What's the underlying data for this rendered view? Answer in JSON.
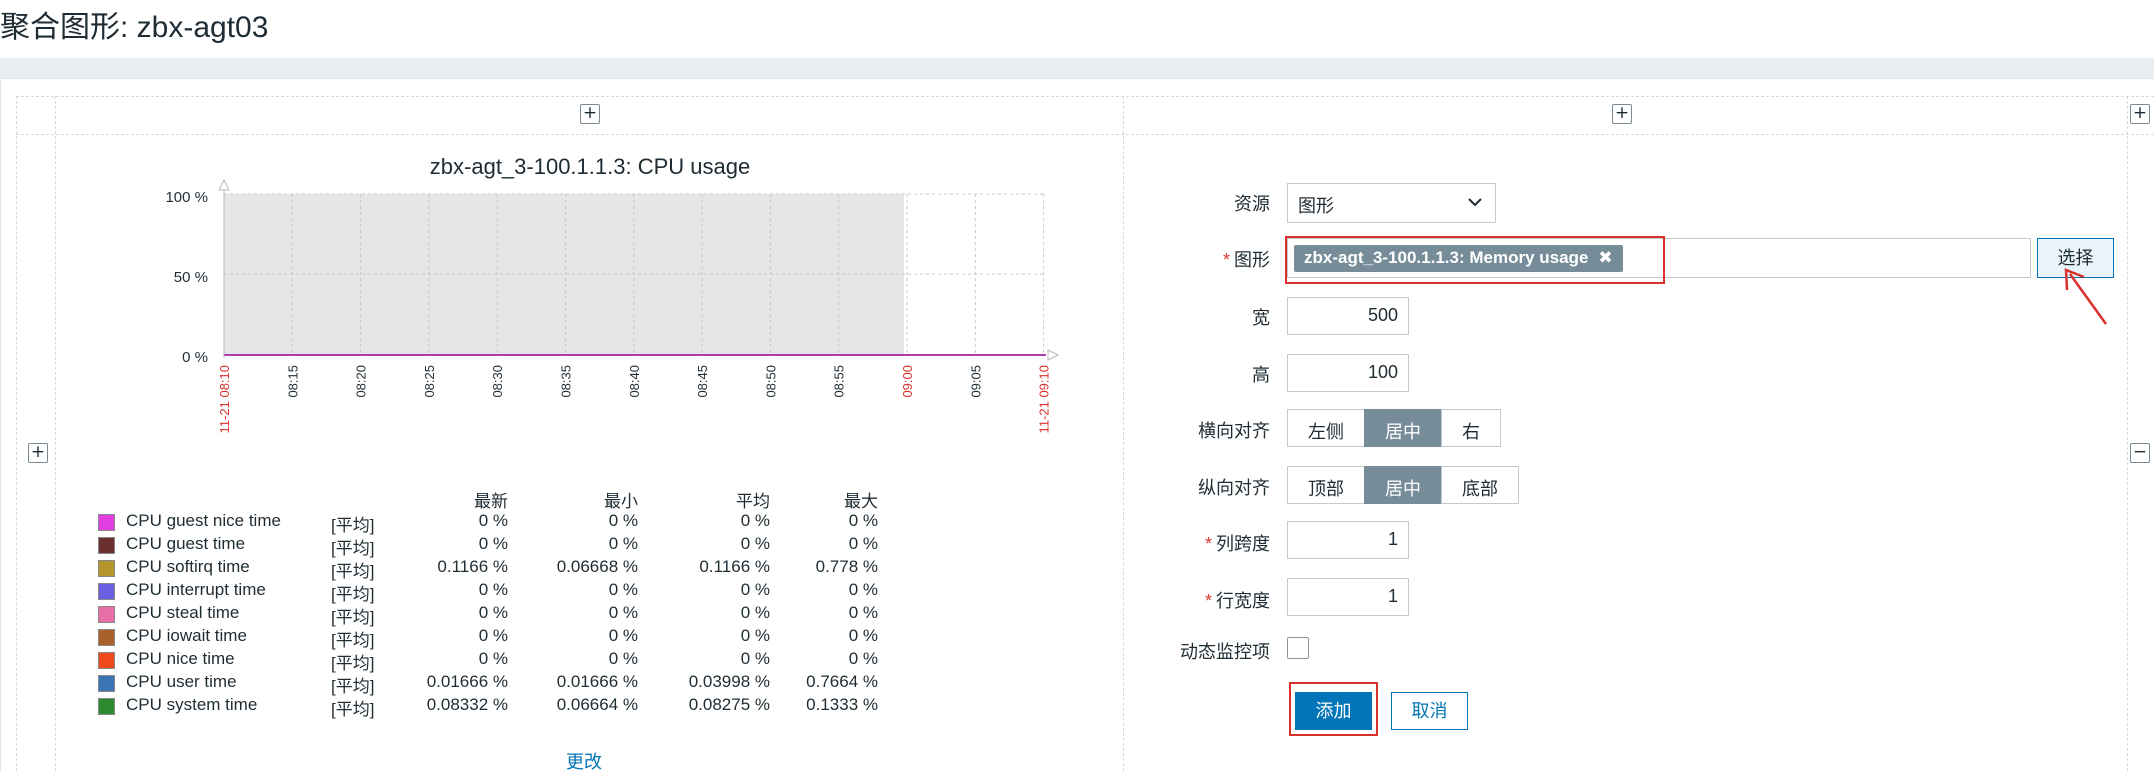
{
  "page": {
    "title": "聚合图形: zbx-agt03"
  },
  "graph": {
    "title": "zbx-agt_3-100.1.1.3: CPU usage",
    "y_ticks": [
      "100 %",
      "50 %",
      "0 %"
    ],
    "x_ticks": [
      "11-21 08:10",
      "08:15",
      "08:20",
      "08:25",
      "08:30",
      "08:35",
      "08:40",
      "08:45",
      "08:50",
      "08:55",
      "09:00",
      "09:05",
      "11-21 09:10"
    ],
    "highlight_ticks": [
      "11-21 08:10",
      "09:00",
      "11-21 09:10"
    ]
  },
  "legend": {
    "headers": {
      "last": "最新",
      "min": "最小",
      "avg": "平均",
      "max": "最大"
    },
    "rows": [
      {
        "color": "#e23ee4",
        "name": "CPU guest nice time",
        "fn": "[平均]",
        "last": "0 %",
        "min": "0 %",
        "avg": "0 %",
        "max": "0 %"
      },
      {
        "color": "#6b2f2f",
        "name": "CPU guest time",
        "fn": "[平均]",
        "last": "0 %",
        "min": "0 %",
        "avg": "0 %",
        "max": "0 %"
      },
      {
        "color": "#b5962c",
        "name": "CPU softirq time",
        "fn": "[平均]",
        "last": "0.1166 %",
        "min": "0.06668 %",
        "avg": "0.1166 %",
        "max": "0.778 %"
      },
      {
        "color": "#6a5fe0",
        "name": "CPU interrupt time",
        "fn": "[平均]",
        "last": "0 %",
        "min": "0 %",
        "avg": "0 %",
        "max": "0 %"
      },
      {
        "color": "#e86ea8",
        "name": "CPU steal time",
        "fn": "[平均]",
        "last": "0 %",
        "min": "0 %",
        "avg": "0 %",
        "max": "0 %"
      },
      {
        "color": "#a8612b",
        "name": "CPU iowait time",
        "fn": "[平均]",
        "last": "0 %",
        "min": "0 %",
        "avg": "0 %",
        "max": "0 %"
      },
      {
        "color": "#ee4a1c",
        "name": "CPU nice time",
        "fn": "[平均]",
        "last": "0 %",
        "min": "0 %",
        "avg": "0 %",
        "max": "0 %"
      },
      {
        "color": "#3a74b2",
        "name": "CPU user time",
        "fn": "[平均]",
        "last": "0.01666 %",
        "min": "0.01666 %",
        "avg": "0.03998 %",
        "max": "0.7664 %"
      },
      {
        "color": "#2e8a2e",
        "name": "CPU system time",
        "fn": "[平均]",
        "last": "0.08332 %",
        "min": "0.06664 %",
        "avg": "0.08275 %",
        "max": "0.1333 %"
      }
    ],
    "change_link": "更改"
  },
  "form": {
    "resource_label": "资源",
    "resource_value": "图形",
    "graph_label": "图形",
    "graph_chip": "zbx-agt_3-100.1.1.3: Memory usage",
    "chip_remove": "✖",
    "select_button": "选择",
    "width_label": "宽",
    "width_value": "500",
    "height_label": "高",
    "height_value": "100",
    "halign_label": "横向对齐",
    "halign_options": [
      "左侧",
      "居中",
      "右"
    ],
    "halign_selected": "居中",
    "valign_label": "纵向对齐",
    "valign_options": [
      "顶部",
      "居中",
      "底部"
    ],
    "valign_selected": "居中",
    "colspan_label": "列跨度",
    "colspan_value": "1",
    "rowspan_label": "行宽度",
    "rowspan_value": "1",
    "dynamic_label": "动态监控项",
    "add_button": "添加",
    "cancel_button": "取消"
  },
  "colors": {
    "accent": "#0275b8",
    "highlight_red": "#d9302c",
    "chip": "#768d99"
  }
}
